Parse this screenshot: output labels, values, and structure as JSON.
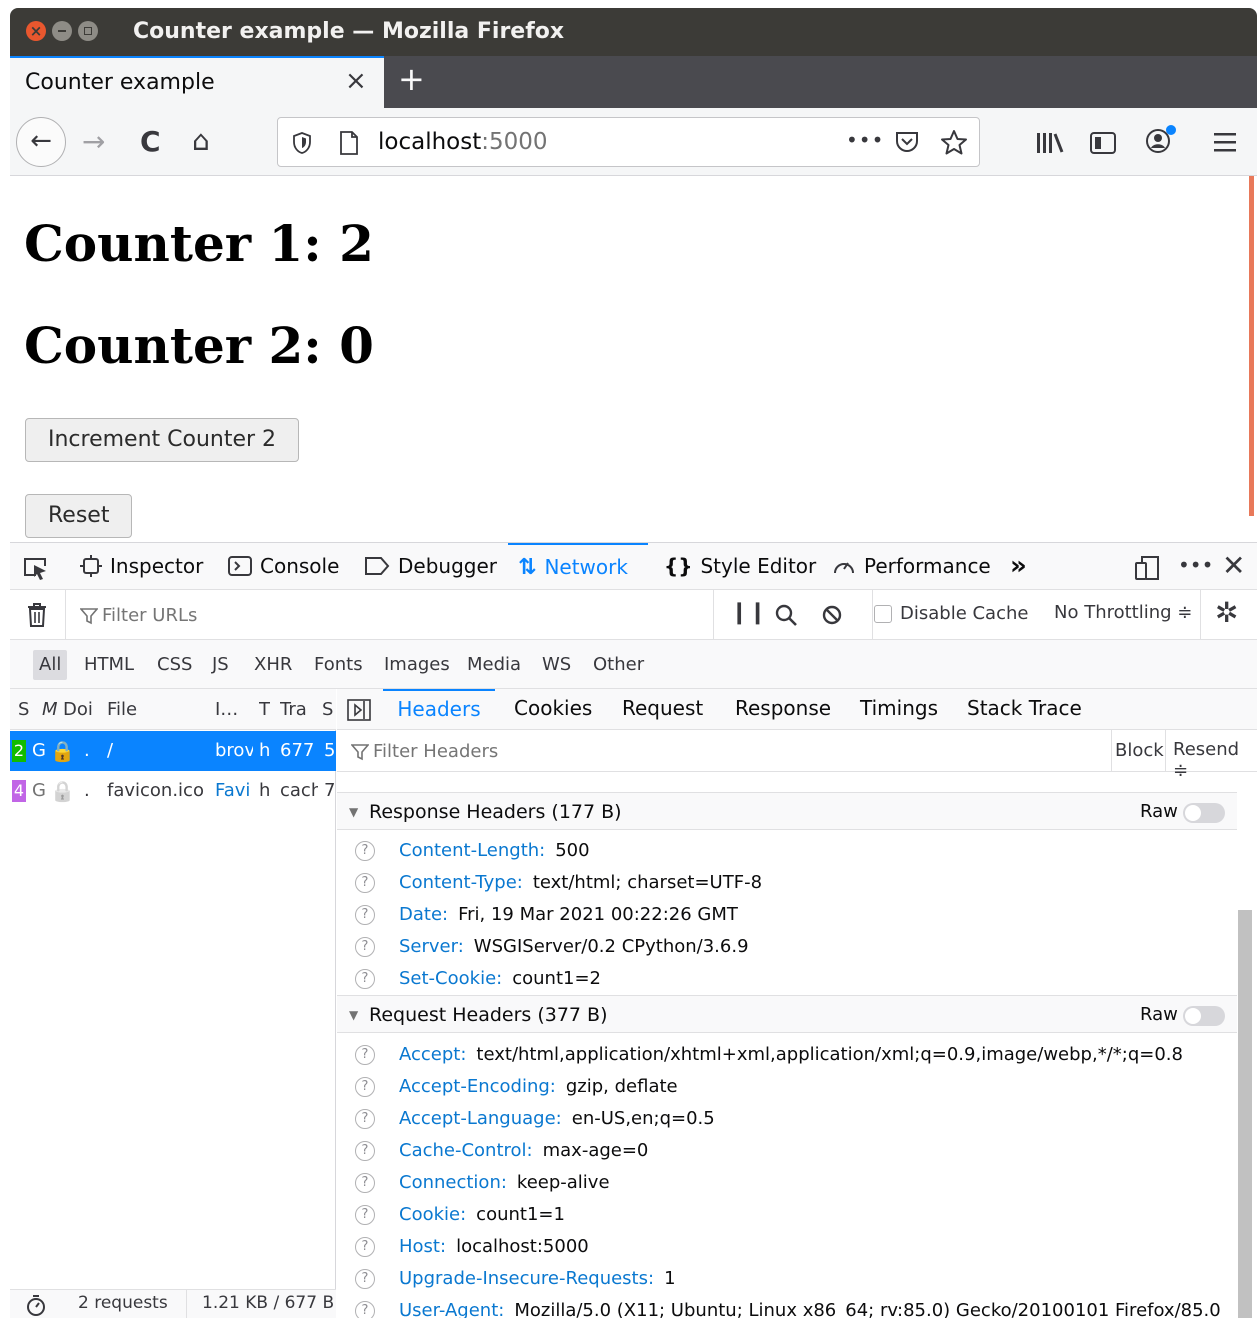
{
  "window": {
    "title": "Counter example — Mozilla Firefox"
  },
  "tabs": [
    {
      "label": "Counter example",
      "close": "×"
    }
  ],
  "newtab_label": "+",
  "nav": {
    "back": "←",
    "forward": "→",
    "reload": "C",
    "home": "⌂",
    "url_host": "localhost",
    "url_port": ":5000",
    "page_actions": "•••"
  },
  "page": {
    "counter1": "Counter 1: 2",
    "counter2": "Counter 2: 0",
    "increment_button": "Increment Counter 2",
    "reset_button": "Reset"
  },
  "devtools": {
    "tabs": [
      {
        "label": "Inspector",
        "icon": "inspector-icon"
      },
      {
        "label": "Console",
        "icon": "console-icon"
      },
      {
        "label": "Debugger",
        "icon": "debugger-icon"
      },
      {
        "label": "Network",
        "icon": "network-icon"
      },
      {
        "label": "Style Editor",
        "icon": "style-editor-icon"
      },
      {
        "label": "Performance",
        "icon": "performance-icon"
      }
    ],
    "more_tabs": "»",
    "filter_urls_placeholder": "Filter URLs",
    "disable_cache": "Disable Cache",
    "throttling": "No Throttling ≑",
    "types": [
      "All",
      "HTML",
      "CSS",
      "JS",
      "XHR",
      "Fonts",
      "Images",
      "Media",
      "WS",
      "Other"
    ],
    "columns": [
      "S",
      "M",
      "Doi",
      "File",
      "I…",
      "T",
      "Tra",
      "S"
    ],
    "requests": [
      {
        "status": "2",
        "method": "G",
        "domain": ".",
        "file": "/",
        "initiator": "brov",
        "type": "h",
        "transferred": "677",
        "size": "5",
        "status_color": "#12bc00"
      },
      {
        "status": "4",
        "method": "G",
        "domain": ".",
        "file": "favicon.ico",
        "initiator": "Favi",
        "type": "h",
        "transferred": "cach",
        "size": "7",
        "status_color": "#c165e6"
      }
    ],
    "detail_tabs": [
      "Headers",
      "Cookies",
      "Request",
      "Response",
      "Timings",
      "Stack Trace"
    ],
    "filter_headers_placeholder": "Filter Headers",
    "block_label": "Block",
    "resend_label": "Resend ≑",
    "raw_label": "Raw",
    "response_headers": {
      "title": "Response Headers (177 B)",
      "items": [
        {
          "name": "Content-Length:",
          "value": "500"
        },
        {
          "name": "Content-Type:",
          "value": "text/html; charset=UTF-8"
        },
        {
          "name": "Date:",
          "value": "Fri, 19 Mar 2021 00:22:26 GMT"
        },
        {
          "name": "Server:",
          "value": "WSGIServer/0.2 CPython/3.6.9"
        },
        {
          "name": "Set-Cookie:",
          "value": "count1=2"
        }
      ]
    },
    "request_headers": {
      "title": "Request Headers (377 B)",
      "items": [
        {
          "name": "Accept:",
          "value": "text/html,application/xhtml+xml,application/xml;q=0.9,image/webp,*/*;q=0.8"
        },
        {
          "name": "Accept-Encoding:",
          "value": "gzip, deflate"
        },
        {
          "name": "Accept-Language:",
          "value": "en-US,en;q=0.5"
        },
        {
          "name": "Cache-Control:",
          "value": "max-age=0"
        },
        {
          "name": "Connection:",
          "value": "keep-alive"
        },
        {
          "name": "Cookie:",
          "value": "count1=1"
        },
        {
          "name": "Host:",
          "value": "localhost:5000"
        },
        {
          "name": "Upgrade-Insecure-Requests:",
          "value": "1"
        },
        {
          "name": "User-Agent:",
          "value": "Mozilla/5.0 (X11; Ubuntu; Linux x86_64; rv:85.0) Gecko/20100101 Firefox/85.0"
        }
      ]
    },
    "status": {
      "requests": "2 requests",
      "transferred": "1.21 KB / 677 B"
    }
  }
}
